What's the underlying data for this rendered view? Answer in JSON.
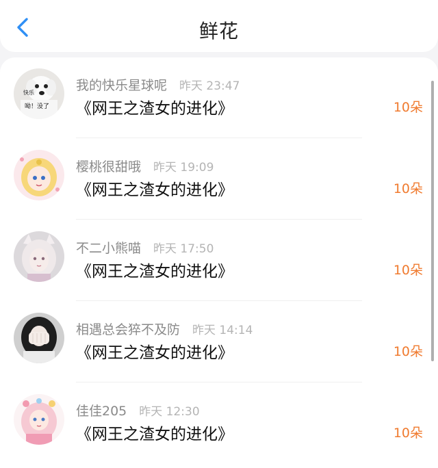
{
  "header": {
    "title": "鲜花",
    "back_icon": "chevron-left-icon",
    "accent_color": "#2f8ff5"
  },
  "records": [
    {
      "username": "我的快乐星球呢",
      "time": "昨天 23:47",
      "book": "《网王之渣女的进化》",
      "amount": "10朵",
      "avatar_text_1": "快乐",
      "avatar_text_2": "呦！没了"
    },
    {
      "username": "樱桃很甜哦",
      "time": "昨天 19:09",
      "book": "《网王之渣女的进化》",
      "amount": "10朵"
    },
    {
      "username": "不二小熊喵",
      "time": "昨天 17:50",
      "book": "《网王之渣女的进化》",
      "amount": "10朵"
    },
    {
      "username": "相遇总会猝不及防",
      "time": "昨天 14:14",
      "book": "《网王之渣女的进化》",
      "amount": "10朵"
    },
    {
      "username": "佳佳205",
      "time": "昨天 12:30",
      "book": "《网王之渣女的进化》",
      "amount": "10朵"
    }
  ],
  "colors": {
    "amount": "#f07a2e",
    "username": "#8a8a8a",
    "time": "#b4b4b4"
  }
}
